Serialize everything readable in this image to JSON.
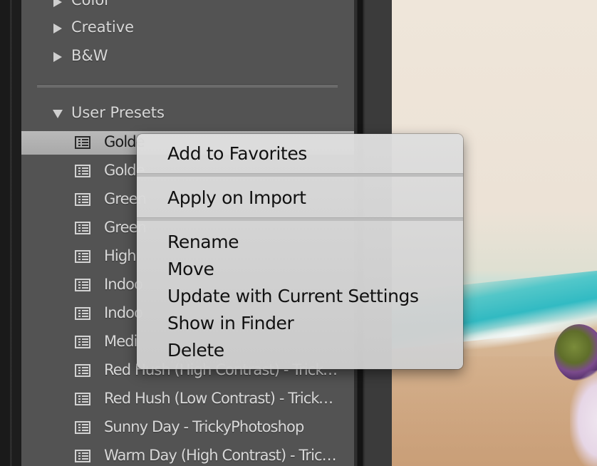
{
  "panel": {
    "groups": [
      {
        "label": "Color",
        "expanded": false
      },
      {
        "label": "Creative",
        "expanded": false
      },
      {
        "label": "B&W",
        "expanded": false
      }
    ],
    "user_presets": {
      "label": "User Presets",
      "expanded": true,
      "items": [
        {
          "label": "Golde",
          "selected": true
        },
        {
          "label": "Golde",
          "selected": false
        },
        {
          "label": "Green",
          "selected": false
        },
        {
          "label": "Green",
          "selected": false
        },
        {
          "label": "High",
          "selected": false
        },
        {
          "label": "Indoo",
          "selected": false
        },
        {
          "label": "Indoo",
          "selected": false
        },
        {
          "label": "Medi",
          "selected": false
        },
        {
          "label": "Red Hush (High Contrast) - TrickyP…",
          "selected": false
        },
        {
          "label": "Red Hush (Low Contrast) - TrickyPh…",
          "selected": false
        },
        {
          "label": "Sunny Day - TrickyPhotoshop",
          "selected": false
        },
        {
          "label": "Warm Day (High Contrast) - TrickyP…",
          "selected": false
        }
      ]
    }
  },
  "context_menu": {
    "sections": [
      [
        "Add to Favorites"
      ],
      [
        "Apply on Import"
      ],
      [
        "Rename",
        "Move",
        "Update with Current Settings",
        "Show in Finder",
        "Delete"
      ]
    ]
  },
  "colors": {
    "panel_bg": "#535353",
    "selected_row": "#b1b1b1",
    "menu_bg": "#d6d6d6",
    "text_light": "#d8d8d8",
    "text_dark": "#111111"
  }
}
